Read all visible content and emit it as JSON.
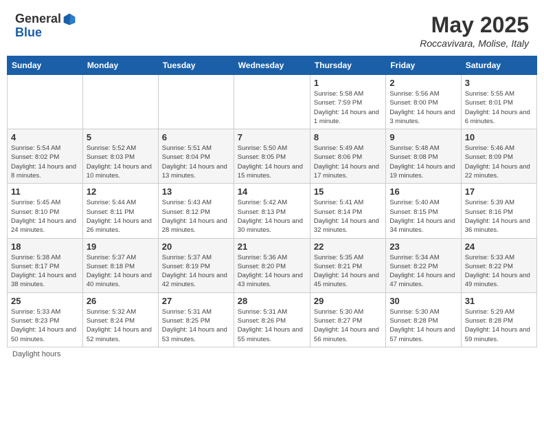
{
  "header": {
    "logo_general": "General",
    "logo_blue": "Blue",
    "month_title": "May 2025",
    "location": "Roccavivara, Molise, Italy"
  },
  "columns": [
    "Sunday",
    "Monday",
    "Tuesday",
    "Wednesday",
    "Thursday",
    "Friday",
    "Saturday"
  ],
  "legend": "Daylight hours",
  "weeks": [
    [
      {
        "day": "",
        "info": ""
      },
      {
        "day": "",
        "info": ""
      },
      {
        "day": "",
        "info": ""
      },
      {
        "day": "",
        "info": ""
      },
      {
        "day": "1",
        "info": "Sunrise: 5:58 AM\nSunset: 7:59 PM\nDaylight: 14 hours and 1 minute."
      },
      {
        "day": "2",
        "info": "Sunrise: 5:56 AM\nSunset: 8:00 PM\nDaylight: 14 hours and 3 minutes."
      },
      {
        "day": "3",
        "info": "Sunrise: 5:55 AM\nSunset: 8:01 PM\nDaylight: 14 hours and 6 minutes."
      }
    ],
    [
      {
        "day": "4",
        "info": "Sunrise: 5:54 AM\nSunset: 8:02 PM\nDaylight: 14 hours and 8 minutes."
      },
      {
        "day": "5",
        "info": "Sunrise: 5:52 AM\nSunset: 8:03 PM\nDaylight: 14 hours and 10 minutes."
      },
      {
        "day": "6",
        "info": "Sunrise: 5:51 AM\nSunset: 8:04 PM\nDaylight: 14 hours and 13 minutes."
      },
      {
        "day": "7",
        "info": "Sunrise: 5:50 AM\nSunset: 8:05 PM\nDaylight: 14 hours and 15 minutes."
      },
      {
        "day": "8",
        "info": "Sunrise: 5:49 AM\nSunset: 8:06 PM\nDaylight: 14 hours and 17 minutes."
      },
      {
        "day": "9",
        "info": "Sunrise: 5:48 AM\nSunset: 8:08 PM\nDaylight: 14 hours and 19 minutes."
      },
      {
        "day": "10",
        "info": "Sunrise: 5:46 AM\nSunset: 8:09 PM\nDaylight: 14 hours and 22 minutes."
      }
    ],
    [
      {
        "day": "11",
        "info": "Sunrise: 5:45 AM\nSunset: 8:10 PM\nDaylight: 14 hours and 24 minutes."
      },
      {
        "day": "12",
        "info": "Sunrise: 5:44 AM\nSunset: 8:11 PM\nDaylight: 14 hours and 26 minutes."
      },
      {
        "day": "13",
        "info": "Sunrise: 5:43 AM\nSunset: 8:12 PM\nDaylight: 14 hours and 28 minutes."
      },
      {
        "day": "14",
        "info": "Sunrise: 5:42 AM\nSunset: 8:13 PM\nDaylight: 14 hours and 30 minutes."
      },
      {
        "day": "15",
        "info": "Sunrise: 5:41 AM\nSunset: 8:14 PM\nDaylight: 14 hours and 32 minutes."
      },
      {
        "day": "16",
        "info": "Sunrise: 5:40 AM\nSunset: 8:15 PM\nDaylight: 14 hours and 34 minutes."
      },
      {
        "day": "17",
        "info": "Sunrise: 5:39 AM\nSunset: 8:16 PM\nDaylight: 14 hours and 36 minutes."
      }
    ],
    [
      {
        "day": "18",
        "info": "Sunrise: 5:38 AM\nSunset: 8:17 PM\nDaylight: 14 hours and 38 minutes."
      },
      {
        "day": "19",
        "info": "Sunrise: 5:37 AM\nSunset: 8:18 PM\nDaylight: 14 hours and 40 minutes."
      },
      {
        "day": "20",
        "info": "Sunrise: 5:37 AM\nSunset: 8:19 PM\nDaylight: 14 hours and 42 minutes."
      },
      {
        "day": "21",
        "info": "Sunrise: 5:36 AM\nSunset: 8:20 PM\nDaylight: 14 hours and 43 minutes."
      },
      {
        "day": "22",
        "info": "Sunrise: 5:35 AM\nSunset: 8:21 PM\nDaylight: 14 hours and 45 minutes."
      },
      {
        "day": "23",
        "info": "Sunrise: 5:34 AM\nSunset: 8:22 PM\nDaylight: 14 hours and 47 minutes."
      },
      {
        "day": "24",
        "info": "Sunrise: 5:33 AM\nSunset: 8:22 PM\nDaylight: 14 hours and 49 minutes."
      }
    ],
    [
      {
        "day": "25",
        "info": "Sunrise: 5:33 AM\nSunset: 8:23 PM\nDaylight: 14 hours and 50 minutes."
      },
      {
        "day": "26",
        "info": "Sunrise: 5:32 AM\nSunset: 8:24 PM\nDaylight: 14 hours and 52 minutes."
      },
      {
        "day": "27",
        "info": "Sunrise: 5:31 AM\nSunset: 8:25 PM\nDaylight: 14 hours and 53 minutes."
      },
      {
        "day": "28",
        "info": "Sunrise: 5:31 AM\nSunset: 8:26 PM\nDaylight: 14 hours and 55 minutes."
      },
      {
        "day": "29",
        "info": "Sunrise: 5:30 AM\nSunset: 8:27 PM\nDaylight: 14 hours and 56 minutes."
      },
      {
        "day": "30",
        "info": "Sunrise: 5:30 AM\nSunset: 8:28 PM\nDaylight: 14 hours and 57 minutes."
      },
      {
        "day": "31",
        "info": "Sunrise: 5:29 AM\nSunset: 8:28 PM\nDaylight: 14 hours and 59 minutes."
      }
    ]
  ]
}
